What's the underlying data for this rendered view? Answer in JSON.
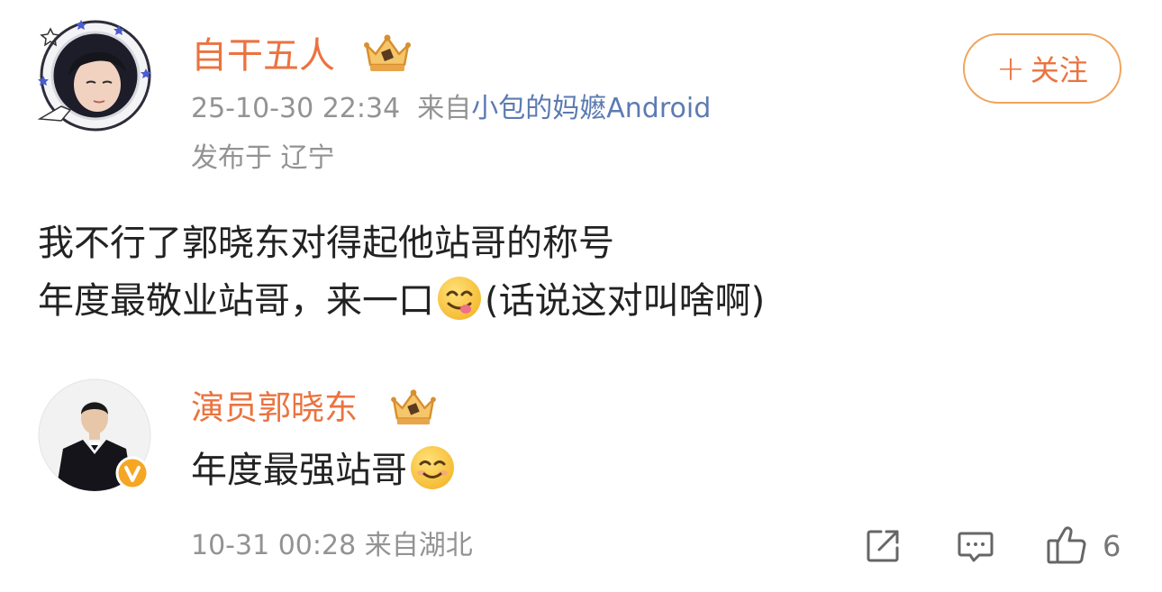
{
  "post": {
    "author": {
      "name": "自干五人",
      "badge_icon": "crown-icon"
    },
    "meta": {
      "time": "25-10-30 22:34",
      "from_label": "来自",
      "source": "小包的妈嬷",
      "platform": "Android"
    },
    "location": "发布于 辽宁",
    "follow_button": {
      "plus": "+",
      "label": "关注"
    },
    "content": {
      "line1": "我不行了郭晓东对得起他站哥的称号",
      "line2_before": "年度最敬业站哥，来一口",
      "line2_emoji": "yum-face-emoji",
      "line2_after": "(话说这对叫啥啊)"
    }
  },
  "reply": {
    "author": {
      "name": "演员郭晓东",
      "badge_icon": "crown-icon",
      "verified_icon": "verified-v-icon"
    },
    "content": {
      "text": "年度最强站哥",
      "emoji": "smile-face-emoji"
    },
    "meta": "10-31 00:28 来自湖北"
  },
  "actions": {
    "share_icon": "share-icon",
    "comment_icon": "comment-icon",
    "like_icon": "thumbs-up-icon",
    "like_count": "6"
  },
  "colors": {
    "accent": "#eb7340",
    "link": "#5b7bb2",
    "meta_gray": "#939393",
    "follow_border": "#f0a45c"
  }
}
